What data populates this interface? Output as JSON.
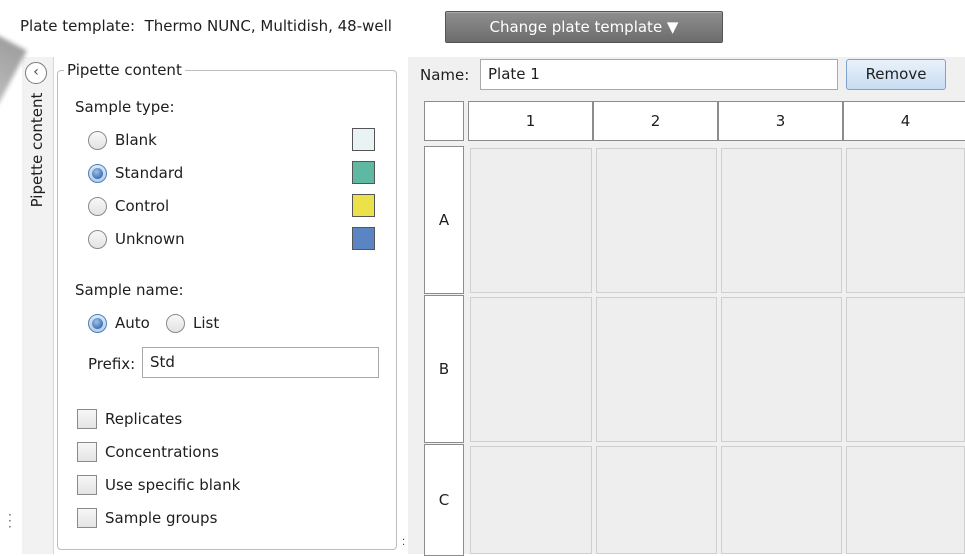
{
  "toolbar": {
    "plate_template_label": "Plate template:",
    "plate_template_value": "Thermo NUNC, Multidish, 48-well",
    "change_template_button": "Change plate template ▼"
  },
  "side_strip": {
    "title": "Pipette content",
    "collapse_icon": "chevron-left-circle-icon"
  },
  "pipette": {
    "title": "Pipette content",
    "sample_type_label": "Sample type:",
    "sample_types": [
      {
        "label": "Blank",
        "checked": false,
        "color": "#eaf3f3"
      },
      {
        "label": "Standard",
        "checked": true,
        "color": "#5fb9a2"
      },
      {
        "label": "Control",
        "checked": false,
        "color": "#ebe14a"
      },
      {
        "label": "Unknown",
        "checked": false,
        "color": "#5a84c2"
      }
    ],
    "sample_name_label": "Sample name:",
    "name_modes": [
      {
        "label": "Auto",
        "checked": true
      },
      {
        "label": "List",
        "checked": false
      }
    ],
    "prefix_label": "Prefix:",
    "prefix_value": "Std",
    "options": [
      {
        "label": "Replicates",
        "checked": false
      },
      {
        "label": "Concentrations",
        "checked": false
      },
      {
        "label": "Use specific blank",
        "checked": false
      },
      {
        "label": "Sample groups",
        "checked": false
      }
    ]
  },
  "plate": {
    "name_label": "Name:",
    "name_value": "Plate 1",
    "remove_button": "Remove",
    "columns": [
      "1",
      "2",
      "3",
      "4"
    ],
    "rows": [
      "A",
      "B",
      "C"
    ]
  }
}
